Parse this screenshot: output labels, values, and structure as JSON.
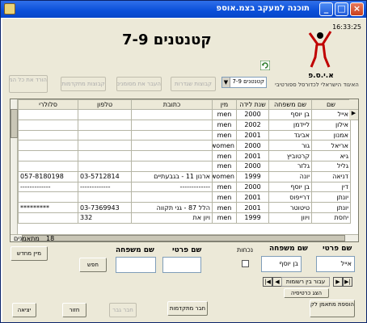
{
  "window": {
    "title": "תוכנה למעקב בצמ.אוספ",
    "minimize": "_",
    "maximize": "□",
    "close": "×"
  },
  "header": {
    "time": "16:33:25",
    "heading": "קטנטנים 7-9",
    "org_name": "א.י.ס.פ",
    "org_sub": "האיגוד הישראלי לכדורסל ספורטיבי"
  },
  "toolbar": {
    "btn_delete": "הורד את כל המתאמנים",
    "btn_groups": "קבוצות מתקדמות",
    "btn_transfer": "העבר את מסומנים",
    "btn_team": "קבוצות שגדרות",
    "combo_value": "קטנטנים 7-9"
  },
  "table": {
    "headers": [
      "שם",
      "שם משפחה",
      "שנת לידה",
      "מין",
      "כתובת",
      "טלפון",
      "סלולרי"
    ],
    "rows": [
      [
        "אייל",
        "בן יוסף",
        "2000",
        "men",
        "",
        "",
        ""
      ],
      [
        "אילון",
        "ליידמן",
        "2002",
        "men",
        "",
        "",
        ""
      ],
      [
        "אמנון",
        "אביגד",
        "2001",
        "men",
        "",
        "",
        ""
      ],
      [
        "אריאל",
        "גור",
        "2000",
        "women",
        "",
        "",
        ""
      ],
      [
        "גיא",
        "קרטוביץ",
        "2001",
        "men",
        "",
        "",
        ""
      ],
      [
        "גליל",
        "גלזר",
        "2000",
        "men",
        "",
        "",
        ""
      ],
      [
        "דניאה",
        "יונה",
        "1999",
        "women",
        "ארנון 11 - בגבעתיים",
        "03-5712814",
        "057-8180198"
      ],
      [
        "דין",
        "בן יוסף",
        "2000",
        "men",
        "-------------",
        "-------------",
        "-------------"
      ],
      [
        "יונתן",
        "דרייפוס",
        "2001",
        "men",
        "",
        "",
        ""
      ],
      [
        "יונתן",
        "טיטוטר",
        "2001",
        "men",
        "הלל 87 - גני תקווה",
        "03-7369943",
        "*********"
      ],
      [
        "יחסת",
        "ויוון",
        "1999",
        "men",
        "ויון את",
        "332",
        ""
      ]
    ],
    "count": "18",
    "count_label": "מתאמנים"
  },
  "search": {
    "first_name_label": "שם פרטי",
    "last_name_label": "שם משפחה",
    "search_button": "חפש",
    "sort_button": "מיין מחדש"
  },
  "detail": {
    "first_name_label": "שם פרטי",
    "last_name_label": "שם משפחה",
    "gender_label": "נכחות",
    "first_name_value": "אייל",
    "last_name_value": "בן יוסף",
    "record_label": "עבור בין רשומות",
    "add_card_button": "הצג כרטיסיה"
  },
  "footer": {
    "exit": "יציאה",
    "back": "חזור",
    "new_group": "חבר גבר",
    "to_group": "חבר מתקדמות",
    "add_trainee": "הוספת מתאמן לקבוצה"
  }
}
